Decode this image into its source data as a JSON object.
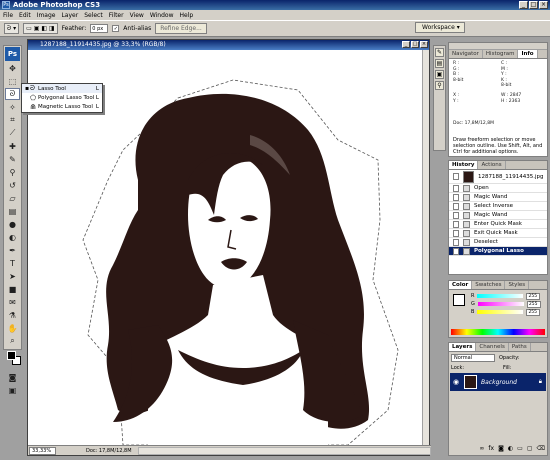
{
  "app": {
    "title": "Adobe Photoshop CS3",
    "logo": "Ps",
    "window_buttons": [
      "_",
      "□",
      "×"
    ]
  },
  "menu": [
    "File",
    "Edit",
    "Image",
    "Layer",
    "Select",
    "Filter",
    "View",
    "Window",
    "Help"
  ],
  "options": {
    "feather_label": "Feather:",
    "feather_value": "0 px",
    "antialias_label": "Anti-alias",
    "antialias_checked": true,
    "refine_edge": "Refine Edge...",
    "workspace": "Workspace"
  },
  "tool_flyout": {
    "items": [
      {
        "label": "Lasso Tool",
        "key": "L",
        "icon": "lasso-icon",
        "active": true
      },
      {
        "label": "Polygonal Lasso Tool",
        "key": "L",
        "icon": "polygonal-lasso-icon",
        "active": false
      },
      {
        "label": "Magnetic Lasso Tool",
        "key": "L",
        "icon": "magnetic-lasso-icon",
        "active": false
      }
    ]
  },
  "document": {
    "title": "1287188_11914435.jpg @ 33,3% (RGB/8)",
    "zoom": "33,33%",
    "doc_info": "Doc: 17,8M/12,8M"
  },
  "navigator": {
    "tabs": [
      "Navigator",
      "Histogram",
      "Info"
    ],
    "active_tab": "Info",
    "info": {
      "col1": [
        "R :",
        "G :",
        "B :",
        "8-bit"
      ],
      "col2": [
        "C :",
        "M :",
        "Y :",
        "K :",
        "8-bit"
      ],
      "col3": [
        "X :",
        "Y :"
      ],
      "col4": [
        "W :",
        "H :"
      ],
      "w_value": "2847",
      "h_value": "2363",
      "doc": "Doc: 17,8M/12,8M",
      "help": "Draw freeform selection or move selection outline. Use Shift, Alt, and Ctrl for additional options."
    }
  },
  "history": {
    "tabs": [
      "History",
      "Actions"
    ],
    "snapshot": "1287188_11914435.jpg",
    "items": [
      {
        "label": "Open",
        "selected": false
      },
      {
        "label": "Magic Wand",
        "selected": false
      },
      {
        "label": "Select Inverse",
        "selected": false
      },
      {
        "label": "Magic Wand",
        "selected": false
      },
      {
        "label": "Enter Quick Mask",
        "selected": false
      },
      {
        "label": "Exit Quick Mask",
        "selected": false
      },
      {
        "label": "Deselect",
        "selected": false
      },
      {
        "label": "Polygonal Lasso",
        "selected": true
      }
    ]
  },
  "color": {
    "tabs": [
      "Color",
      "Swatches",
      "Styles"
    ],
    "channels": [
      {
        "label": "R",
        "value": "255"
      },
      {
        "label": "G",
        "value": "255"
      },
      {
        "label": "B",
        "value": "255"
      }
    ]
  },
  "layers": {
    "tabs": [
      "Layers",
      "Channels",
      "Paths"
    ],
    "blend_mode": "Normal",
    "opacity_label": "Opacity:",
    "lock_label": "Lock:",
    "fill_label": "Fill:",
    "layer_name": "Background"
  },
  "colors": {
    "titlebar": "#0a246a",
    "selected": "#0a246a",
    "hair": "#2b1714",
    "panel": "#d4d0c8"
  }
}
